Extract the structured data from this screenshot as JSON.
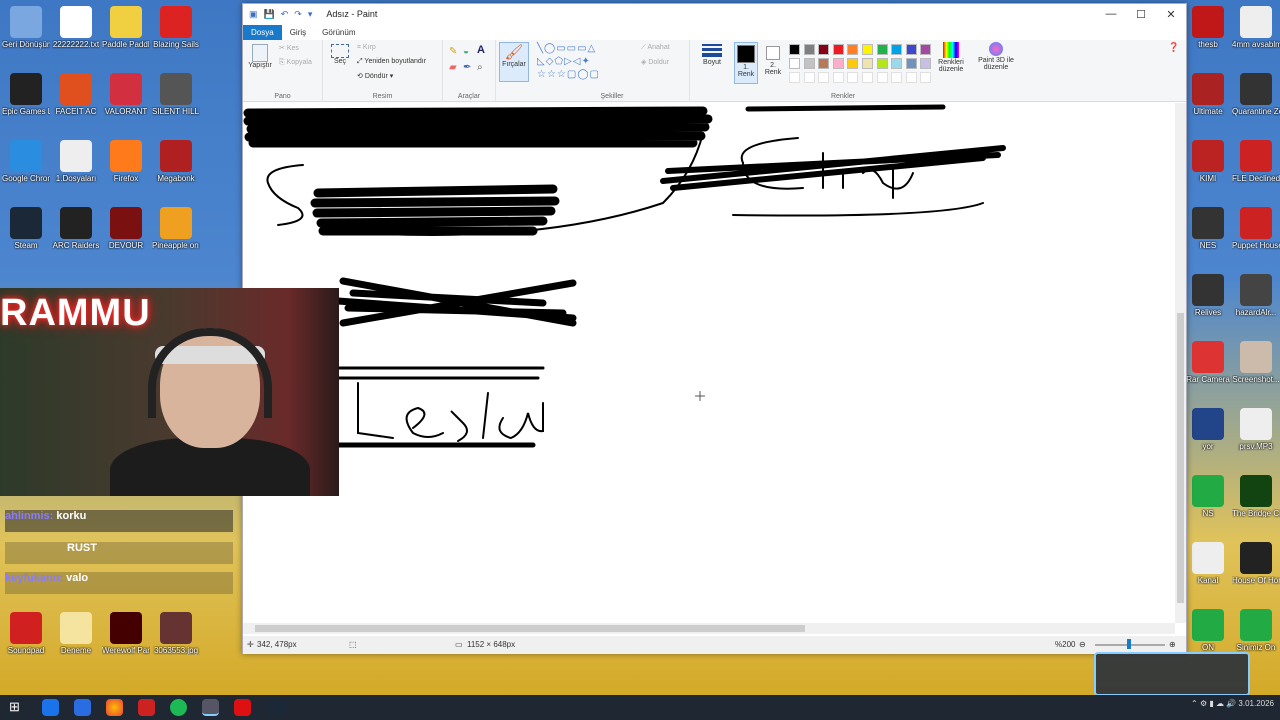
{
  "window": {
    "title": "Adsız - Paint",
    "controls": {
      "minimize": "—",
      "maximize": "☐",
      "close": "✕"
    }
  },
  "menu_tabs": [
    "Dosya",
    "Giriş",
    "Görünüm"
  ],
  "ribbon": {
    "pano": {
      "group_label": "Pano",
      "paste": "Yapıştır",
      "cut": "Kes",
      "copy": "Kopyala"
    },
    "resim": {
      "group_label": "Resim",
      "select": "Seç",
      "crop": "Kırp",
      "resize": "Yeniden boyutlandır",
      "rotate": "Döndür"
    },
    "araclar": {
      "group_label": "Araçlar"
    },
    "fircalar": {
      "label": "Fırçalar"
    },
    "sekiller": {
      "group_label": "Şekiller",
      "outline": "Anahat",
      "fill": "Doldur"
    },
    "boyut": {
      "label": "Boyut"
    },
    "colors": {
      "group_label": "Renkler",
      "color1": "1. Renk",
      "color2": "2. Renk",
      "edit_colors": "Renkleri düzenle",
      "paint3d": "Paint 3D ile düzenle",
      "palette_row1": [
        "#000000",
        "#7f7f7f",
        "#880015",
        "#ed1c24",
        "#ff7f27",
        "#fff200",
        "#22b14c",
        "#00a2e8",
        "#3f48cc",
        "#a349a4"
      ],
      "palette_row2": [
        "#ffffff",
        "#c3c3c3",
        "#b97a57",
        "#ffaec9",
        "#ffc90e",
        "#efe4b0",
        "#b5e61d",
        "#99d9ea",
        "#7092be",
        "#c8bfe7"
      ]
    }
  },
  "statusbar": {
    "cursor_pos": "342, 478px",
    "canvas_size": "1152 × 648px",
    "zoom": "%200"
  },
  "chat": [
    {
      "user": "ahlinmis:",
      "message": "korku"
    },
    {
      "user": "",
      "message": "RUST"
    },
    {
      "user": "keyfukann:",
      "message": "valo"
    }
  ],
  "webcam": {
    "neon_text": "RAMMU"
  },
  "desktop_icons_left": [
    {
      "label": "Geri Dönüşüm",
      "color": "#7aa7e0"
    },
    {
      "label": "22222222.txt",
      "color": "#ffffff"
    },
    {
      "label": "Paddle Paddle",
      "color": "#f0d040"
    },
    {
      "label": "Blazing Sails",
      "color": "#d22"
    },
    {
      "label": "Epic Games Launcher",
      "color": "#222"
    },
    {
      "label": "FACEIT AC",
      "color": "#e0501e"
    },
    {
      "label": "VALORANT",
      "color": "#d23040"
    },
    {
      "label": "SILENT HILL f",
      "color": "#555"
    },
    {
      "label": "Google Chrome",
      "color": "#2a8de0"
    },
    {
      "label": "1.Dosyaları",
      "color": "#eee"
    },
    {
      "label": "Firefox",
      "color": "#ff7a1a"
    },
    {
      "label": "Megabonk",
      "color": "#b02020"
    },
    {
      "label": "Steam",
      "color": "#1b2838"
    },
    {
      "label": "ARC Raiders",
      "color": "#222"
    },
    {
      "label": "DEVOUR",
      "color": "#7a1010"
    },
    {
      "label": "Pineapple on pizza",
      "color": "#f0a020"
    }
  ],
  "desktop_icons_lower": [
    {
      "label": "Soundpad",
      "color": "#d02020"
    },
    {
      "label": "Deneme",
      "color": "#f4e4a0"
    },
    {
      "label": "Werewolf Party",
      "color": "#400"
    },
    {
      "label": "3063553.jpg",
      "color": "#633"
    }
  ],
  "desktop_icons_right": [
    {
      "label": "thesb",
      "color": "#c01818"
    },
    {
      "label": "4mm avsablmMP3",
      "color": "#eee"
    },
    {
      "label": "Ultimate",
      "color": "#a22"
    },
    {
      "label": "Quarantine Zone The...",
      "color": "#333"
    },
    {
      "label": "KIMI",
      "color": "#b22"
    },
    {
      "label": "FLE Declined",
      "color": "#c22"
    },
    {
      "label": "NES",
      "color": "#333"
    },
    {
      "label": "Puppet House",
      "color": "#c22"
    },
    {
      "label": "Relives",
      "color": "#333"
    },
    {
      "label": "hazardAlr...",
      "color": "#444"
    },
    {
      "label": "Rar Camera",
      "color": "#d33"
    },
    {
      "label": "Screenshot...",
      "color": "#cba"
    },
    {
      "label": "yor",
      "color": "#248"
    },
    {
      "label": "prsv.MP3",
      "color": "#eee"
    },
    {
      "label": "NS",
      "color": "#2a4"
    },
    {
      "label": "The Bridge Curse 2 T...",
      "color": "#141"
    },
    {
      "label": "Kanal",
      "color": "#eee"
    },
    {
      "label": "House Of Horror On...",
      "color": "#222"
    },
    {
      "label": "ON",
      "color": "#2a4"
    },
    {
      "label": "Sinimiz On",
      "color": "#2a4"
    }
  ],
  "tray": {
    "date": "3.01.2026"
  }
}
